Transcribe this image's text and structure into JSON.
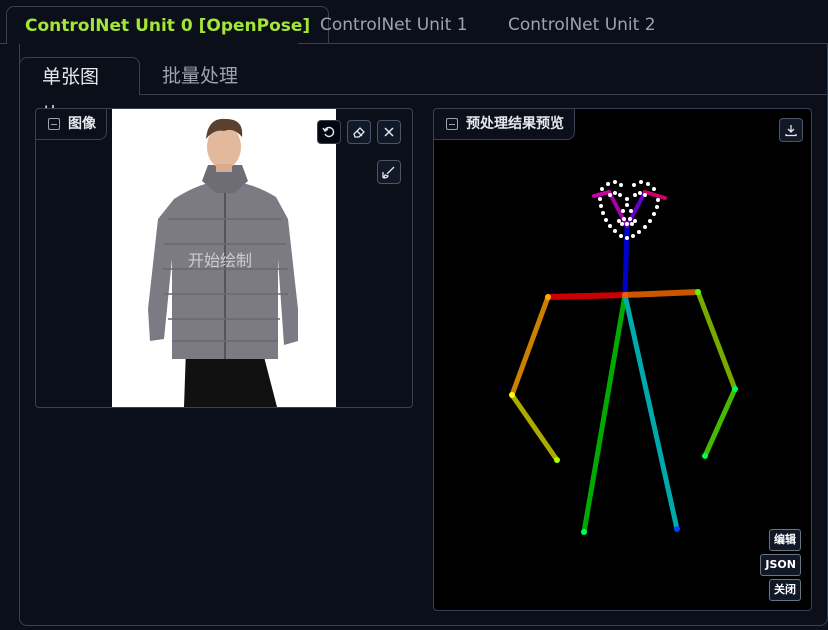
{
  "unit_tabs": [
    {
      "label": "ControlNet Unit 0 [OpenPose]",
      "active": true
    },
    {
      "label": "ControlNet Unit 1",
      "active": false
    },
    {
      "label": "ControlNet Unit 2",
      "active": false
    }
  ],
  "sub_tabs": [
    {
      "label": "单张图片",
      "active": true
    },
    {
      "label": "批量处理",
      "active": false
    }
  ],
  "image_panel": {
    "label": "图像",
    "canvas_hint": "开始绘制",
    "tools": [
      "undo-icon",
      "eraser-icon",
      "close-icon",
      "brush-icon"
    ]
  },
  "preview_panel": {
    "label": "预处理结果预览",
    "download_icon": "download-icon",
    "buttons": {
      "edit": "编辑",
      "json": "JSON",
      "close": "关闭"
    }
  },
  "colors": {
    "background": "#0b0f19",
    "border": "#374151",
    "active_tab": "#a3e635"
  }
}
